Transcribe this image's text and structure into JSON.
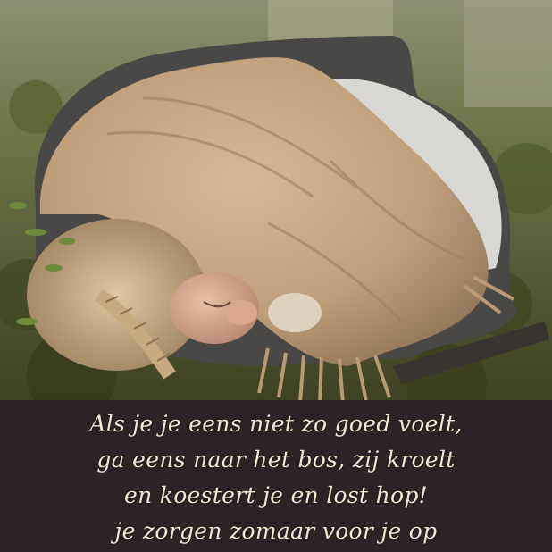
{
  "caption": {
    "lines": [
      "Als je je eens niet zo goed voelt,",
      "ga eens naar het bos, zij kroelt",
      "en koestert je en lost hop!",
      "je zorgen zomaar voor je op"
    ]
  },
  "colors": {
    "caption_background": "#2b2326",
    "caption_text": "#f2e6d2",
    "blanket": "#c7ab89",
    "forest_floor": "#4f5a2c"
  }
}
